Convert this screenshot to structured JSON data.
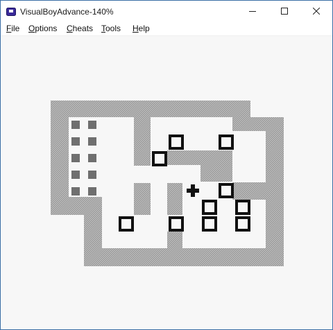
{
  "window": {
    "title": "VisualBoyAdvance-140%"
  },
  "menu": {
    "items": [
      "File",
      "Options",
      "Cheats",
      "Tools",
      "Help"
    ]
  },
  "icons": {
    "app": "vba-app-icon",
    "minimize": "minimize-icon",
    "maximize": "maximize-icon",
    "close": "close-icon"
  },
  "colors": {
    "title_text": "#1a1a1a",
    "window_border": "#3a6ea5",
    "game_background": "#f7f7f7",
    "wall": "#a8a8a8",
    "box_outline": "#111111",
    "goal": "#6f6f6f",
    "player": "#111111"
  }
}
